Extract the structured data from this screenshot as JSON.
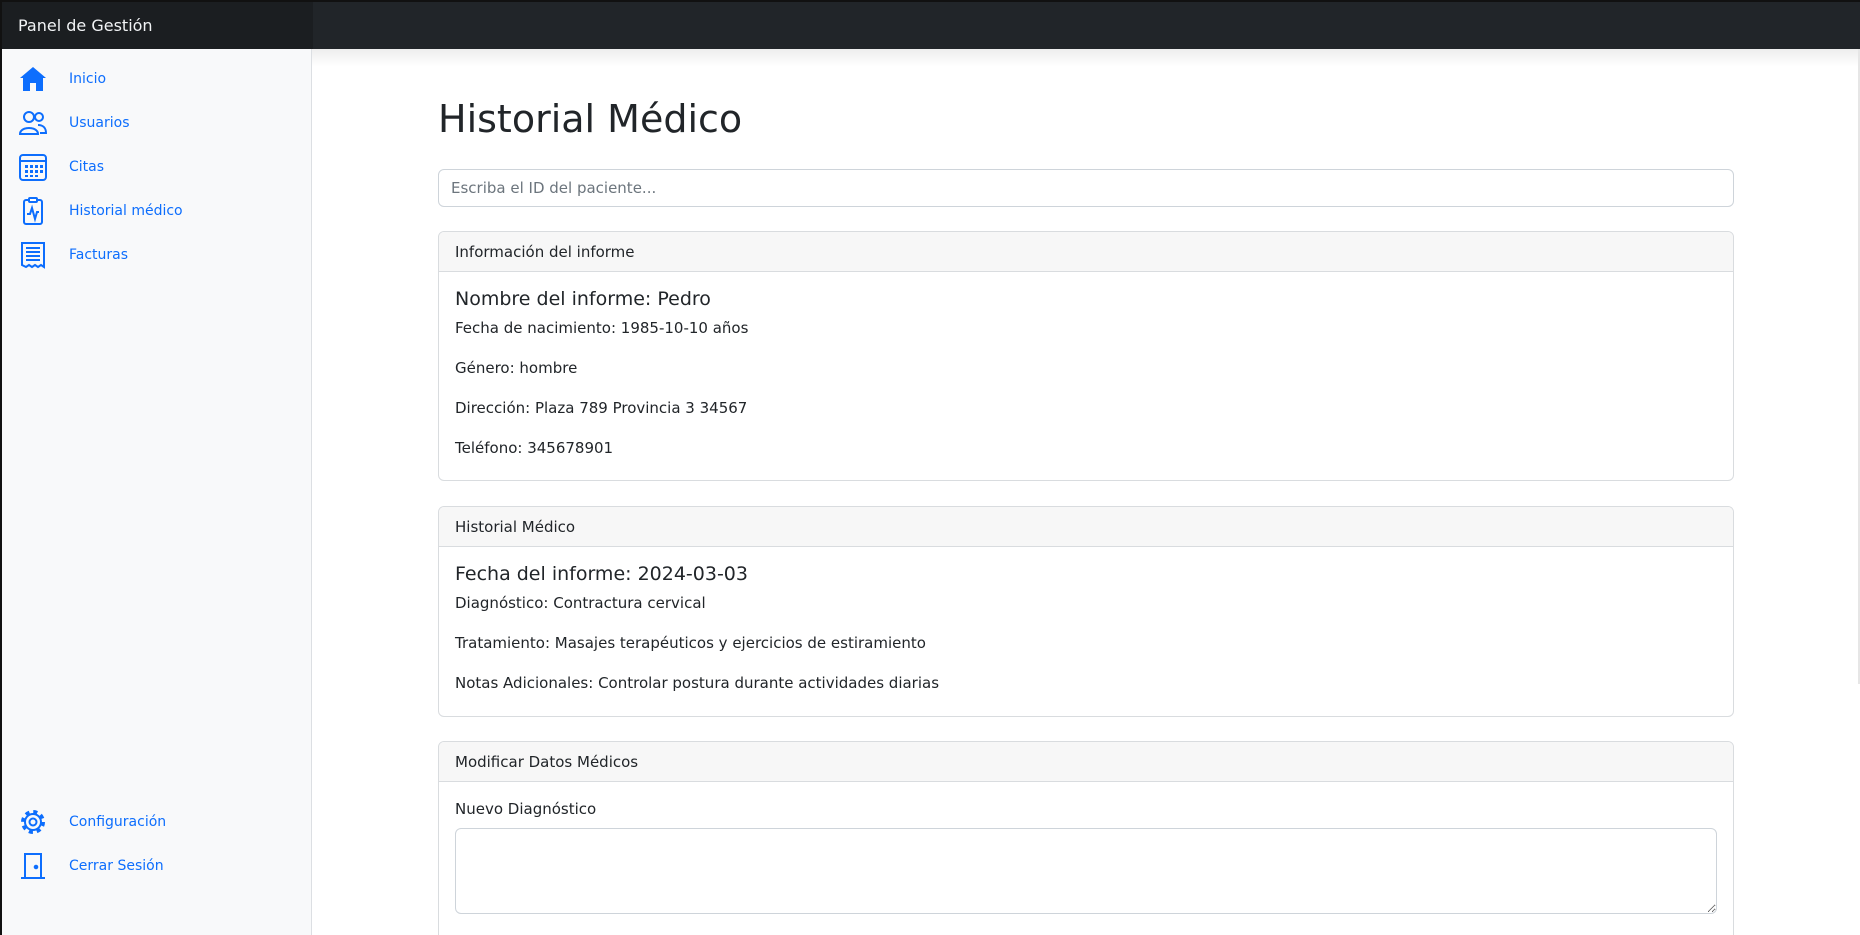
{
  "app": {
    "brand": "Panel de Gestión"
  },
  "sidebar": {
    "items": [
      {
        "label": "Inicio",
        "icon": "house-icon"
      },
      {
        "label": "Usuarios",
        "icon": "users-icon"
      },
      {
        "label": "Citas",
        "icon": "calendar-icon"
      },
      {
        "label": "Historial médico",
        "icon": "clipboard-pulse-icon"
      },
      {
        "label": "Facturas",
        "icon": "receipt-icon"
      }
    ],
    "bottom_items": [
      {
        "label": "Configuración",
        "icon": "gear-icon"
      },
      {
        "label": "Cerrar Sesión",
        "icon": "door-icon"
      }
    ]
  },
  "main": {
    "title": "Historial Médico",
    "search": {
      "placeholder": "Escriba el ID del paciente...",
      "value": ""
    },
    "report_info": {
      "header": "Información del informe",
      "title": "Nombre del informe: Pedro",
      "lines": [
        "Fecha de nacimiento: 1985-10-10 años",
        "Género: hombre",
        "Dirección: Plaza 789 Provincia 3 34567",
        "Teléfono: 345678901"
      ]
    },
    "medical_history": {
      "header": "Historial Médico",
      "title": "Fecha del informe: 2024-03-03",
      "lines": [
        "Diagnóstico: Contractura cervical",
        "Tratamiento: Masajes terapéuticos y ejercicios de estiramiento",
        "Notas Adicionales: Controlar postura durante actividades diarias"
      ]
    },
    "modify": {
      "header": "Modificar Datos Médicos",
      "diagnosis_label": "Nuevo Diagnóstico",
      "diagnosis_value": ""
    }
  },
  "colors": {
    "accent": "#0d6efd",
    "topbar": "#212529",
    "sidebar": "#f8f9fa"
  }
}
